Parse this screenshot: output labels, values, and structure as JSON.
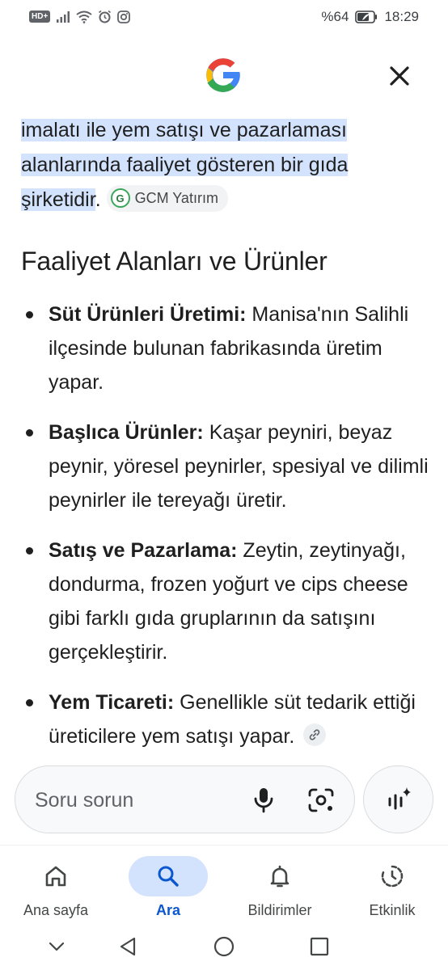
{
  "status_bar": {
    "hd_badge": "HD+",
    "battery": "%64",
    "time": "18:29"
  },
  "header": {
    "logo_icon": "google-g-icon",
    "close_icon": "close-icon"
  },
  "intro": {
    "line_highlighted": "imalatı ile yem satışı ve pazarlaması alanlarında faaliyet gösteren bir gıda şirketidir",
    "trailing": ".",
    "source_label": "GCM Yatırım"
  },
  "section_title": "Faaliyet Alanları ve Ürünler",
  "bullets": [
    {
      "term": "Süt Ürünleri Üretimi:",
      "text": " Manisa'nın Salihli ilçesinde bulunan fabrikasında üretim yapar."
    },
    {
      "term": "Başlıca Ürünler:",
      "text": " Kaşar peyniri, beyaz peynir, yöresel peynirler, spesiyal ve dilimli peynirler ile tereyağı üretir."
    },
    {
      "term": "Satış ve Pazarlama:",
      "text": " Zeytin, zeytinyağı, dondurma, frozen yoğurt ve cips cheese gibi farklı gıda gruplarının da satışını gerçekleştirir."
    },
    {
      "term": "Yem Ticareti:",
      "text": " Genellikle süt tedarik ettiği üreticilere yem satışı yapar."
    }
  ],
  "search": {
    "placeholder": "Soru sorun"
  },
  "bottom_nav": [
    {
      "label": "Ana sayfa",
      "icon": "home-icon"
    },
    {
      "label": "Ara",
      "icon": "search-icon"
    },
    {
      "label": "Bildirimler",
      "icon": "bell-icon"
    },
    {
      "label": "Etkinlik",
      "icon": "activity-icon"
    }
  ],
  "colors": {
    "accent": "#0b57d0",
    "highlight": "#d3e3fd",
    "nav_active_pill": "#d3e3fd"
  }
}
